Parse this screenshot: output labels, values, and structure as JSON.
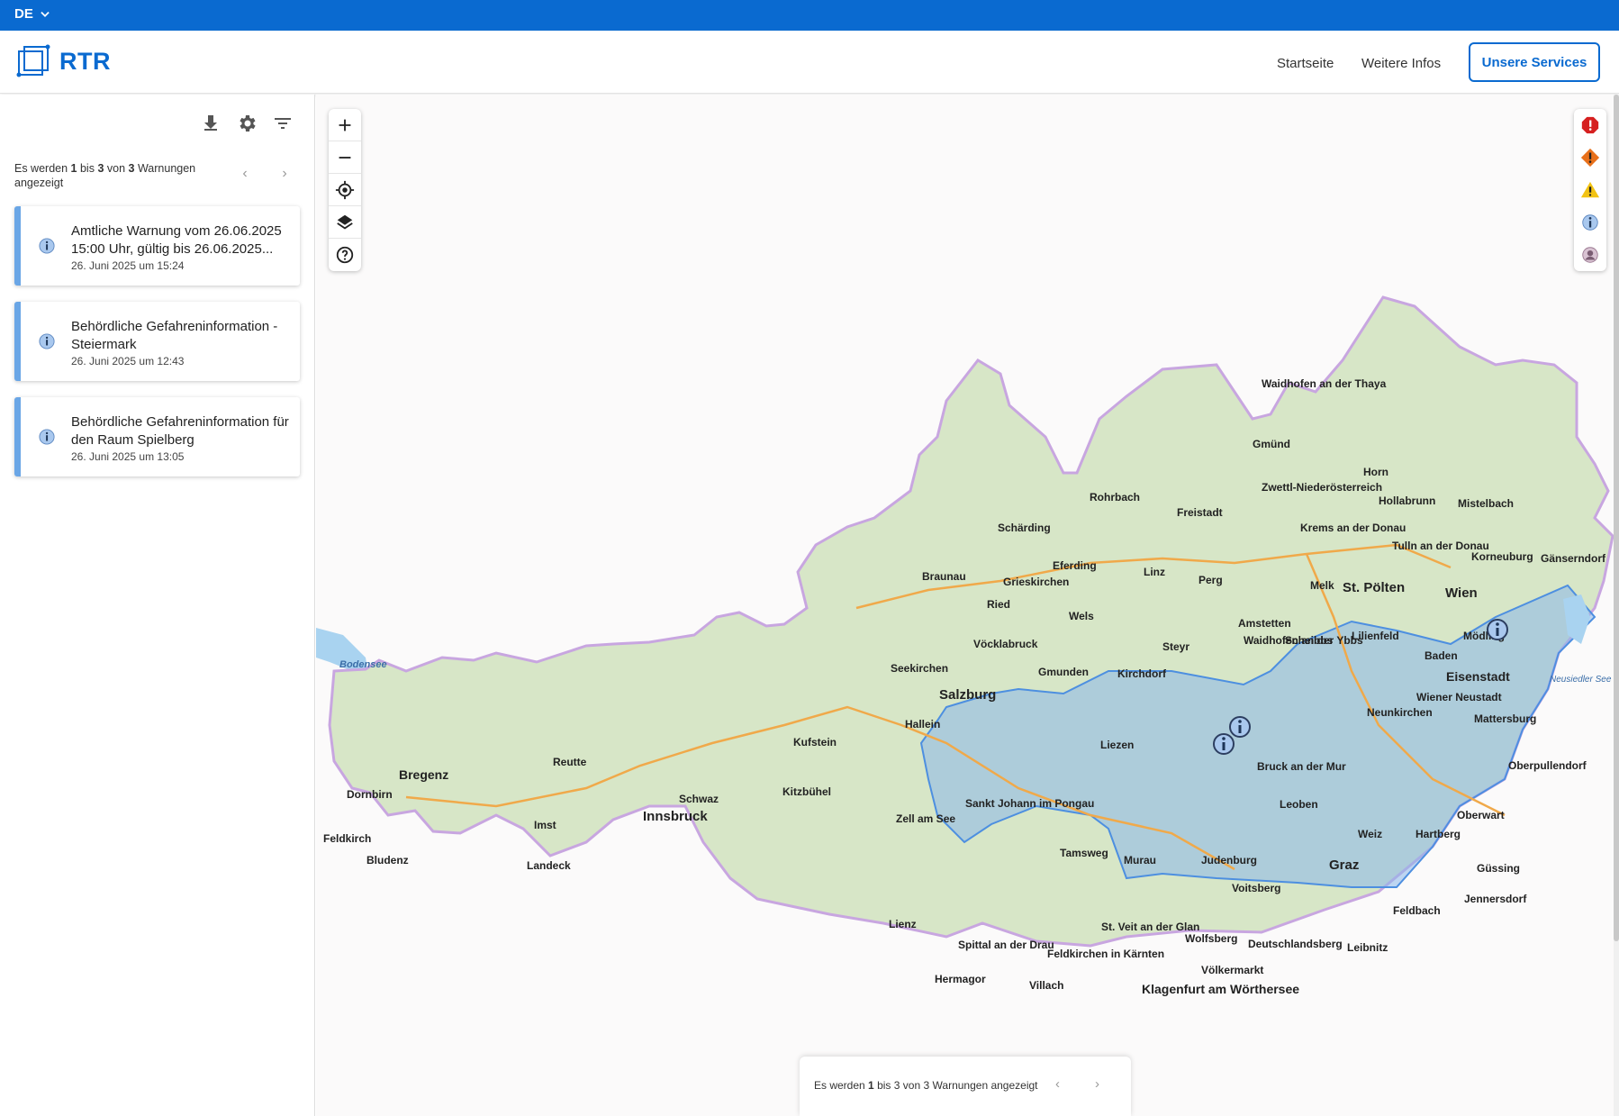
{
  "topbar": {
    "language": "DE"
  },
  "header": {
    "logo_text": "RTR",
    "nav": {
      "home": "Startseite",
      "more_info": "Weitere Infos",
      "services": "Unsere Services"
    }
  },
  "sidebar": {
    "pager": {
      "prefix": "Es werden",
      "from": "1",
      "to_word": "bis",
      "to": "3",
      "of_word": "von",
      "total": "3",
      "suffix": "Warnungen angezeigt"
    },
    "warnings": [
      {
        "title": "Amtliche Warnung vom 26.06.2025 15:00 Uhr, gültig bis 26.06.2025...",
        "date": "26. Juni 2025 um 15:24",
        "icon": "info-icon"
      },
      {
        "title": "Behördliche Gefahreninformation - Steiermark",
        "date": "26. Juni 2025 um 12:43",
        "icon": "info-icon"
      },
      {
        "title": "Behördliche Gefahreninformation für den Raum Spielberg",
        "date": "26. Juni 2025 um 13:05",
        "icon": "info-icon"
      }
    ]
  },
  "map": {
    "labels": {
      "waidhofen_thaya": "Waidhofen an der Thaya",
      "gmuend": "Gmünd",
      "zwettl": "Zwettl-Niederösterreich",
      "horn": "Horn",
      "hollabrunn": "Hollabrunn",
      "mistelbach": "Mistelbach",
      "rohrbach": "Rohrbach",
      "freistadt": "Freistadt",
      "schaerding": "Schärding",
      "krems": "Krems an der Donau",
      "tulln": "Tulln an der Donau",
      "korneuburg": "Korneuburg",
      "gaensernd": "Gänserndorf",
      "braunau": "Braunau",
      "eferding": "Eferding",
      "linz": "Linz",
      "perg": "Perg",
      "melk": "Melk",
      "st_poelten": "St. Pölten",
      "wien": "Wien",
      "ried": "Ried",
      "grieskirchen": "Grieskirchen",
      "wels": "Wels",
      "amstetten": "Amstetten",
      "voecklabruck": "Vöcklabruck",
      "steyr": "Steyr",
      "waidhofen_ybbs": "Waidhofen an der Ybbs",
      "scheibbs": "Scheibbs",
      "lilienfeld": "Lilienfeld",
      "moedling": "Mödling",
      "baden": "Baden",
      "seekirchen": "Seekirchen",
      "gmunden": "Gmunden",
      "kirchdorf": "Kirchdorf",
      "eisenstadt": "Eisenstadt",
      "salzburg": "Salzburg",
      "hallein": "Hallein",
      "wiener_neustadt": "Wiener Neustadt",
      "neunkirchen": "Neunkirchen",
      "mattersburg": "Mattersburg",
      "liezen": "Liezen",
      "bruck": "Bruck an der Mur",
      "leoben": "Leoben",
      "oberpullendorf": "Oberpullendorf",
      "kufstein": "Kufstein",
      "reutte": "Reutte",
      "bregenz": "Bregenz",
      "dornbirn": "Dornbirn",
      "feldkirch": "Feldkirch",
      "bludenz": "Bludenz",
      "imst": "Imst",
      "landeck": "Landeck",
      "innsbruck": "Innsbruck",
      "schwaz": "Schwaz",
      "kitzbuehel": "Kitzbühel",
      "zell": "Zell am See",
      "st_johann": "Sankt Johann im Pongau",
      "tamsweg": "Tamsweg",
      "murau": "Murau",
      "judenburg": "Judenburg",
      "weiz": "Weiz",
      "hartberg": "Hartberg",
      "oberwart": "Oberwart",
      "graz": "Graz",
      "voitsberg": "Voitsberg",
      "guessing": "Güssing",
      "jennersdorf": "Jennersdorf",
      "feldbach": "Feldbach",
      "lienz": "Lienz",
      "st_veit": "St. Veit an der Glan",
      "wolfsberg": "Wolfsberg",
      "deutschlandsberg": "Deutschlandsberg",
      "leibnitz": "Leibnitz",
      "spittal": "Spittal an der Drau",
      "feldkirchen": "Feldkirchen in Kärnten",
      "hermagor": "Hermagor",
      "villach": "Villach",
      "voelkermarkt": "Völkermarkt",
      "klagenfurt": "Klagenfurt am Wörthersee",
      "bodensee": "Bodensee",
      "neusiedler": "Neusiedler See"
    }
  },
  "legend": [
    "severe-warning-icon",
    "warning-icon",
    "caution-icon",
    "info-icon",
    "user-icon"
  ],
  "bottom_pager": {
    "text_prefix": "Es werden",
    "from": "1",
    "to_word": "bis",
    "to": "3",
    "of_word": "von",
    "total": "3",
    "suffix": "Warnungen angezeigt"
  },
  "colors": {
    "brand": "#0a6ad0",
    "card_accent": "#6aa6e6",
    "region_fill": "#8ab6ea"
  }
}
